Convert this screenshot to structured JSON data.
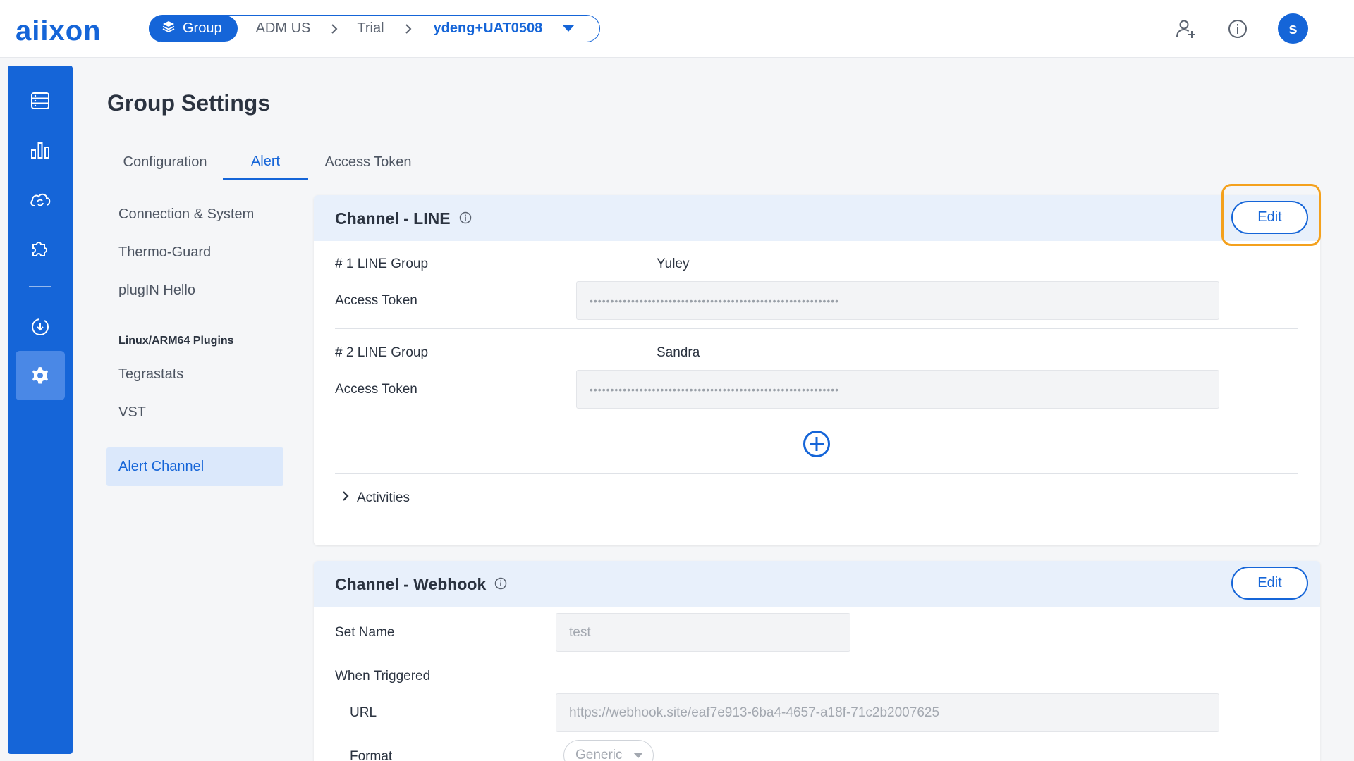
{
  "app": {
    "logo": "aiixon"
  },
  "breadcrumb": {
    "group_label": "Group",
    "items": [
      "ADM US",
      "Trial"
    ],
    "current": "ydeng+UAT0508"
  },
  "header": {
    "avatar_initial": "s",
    "icons": [
      "add-user-icon",
      "info-icon"
    ]
  },
  "rail": {
    "icons": [
      "server-icon",
      "chart-icon",
      "cloud-sync-icon",
      "plugin-icon",
      "ota-icon",
      "gear-icon"
    ],
    "active": "gear-icon"
  },
  "page": {
    "title": "Group Settings",
    "tabs": [
      "Configuration",
      "Alert",
      "Access Token"
    ],
    "active_tab": "Alert"
  },
  "subnav": {
    "items": [
      "Connection & System",
      "Thermo-Guard",
      "plugIN Hello"
    ],
    "section_header": "Linux/ARM64 Plugins",
    "plugin_items": [
      "Tegrastats",
      "VST"
    ],
    "active_item": "Alert Channel"
  },
  "line_channel": {
    "title": "Channel - LINE",
    "edit_label": "Edit",
    "groups": [
      {
        "group_label": "# 1 LINE Group",
        "group_value": "Yuley",
        "token_label": "Access Token",
        "token_value": "••••••••••••••••••••••••••••••••••••••••••••••••••••••••••••"
      },
      {
        "group_label": "# 2 LINE Group",
        "group_value": "Sandra",
        "token_label": "Access Token",
        "token_value": "••••••••••••••••••••••••••••••••••••••••••••••••••••••••••••"
      }
    ],
    "activities_label": "Activities"
  },
  "webhook_channel": {
    "title": "Channel - Webhook",
    "edit_label": "Edit",
    "set_name_label": "Set Name",
    "set_name_value": "test",
    "when_triggered_label": "When Triggered",
    "url_label": "URL",
    "url_value": "https://webhook.site/eaf7e913-6ba4-4657-a18f-71c2b2007625",
    "format_label": "Format",
    "format_value": "Generic"
  },
  "colors": {
    "primary": "#1565d8",
    "highlight": "#f4a11d",
    "card_header": "#e8f0fb"
  }
}
